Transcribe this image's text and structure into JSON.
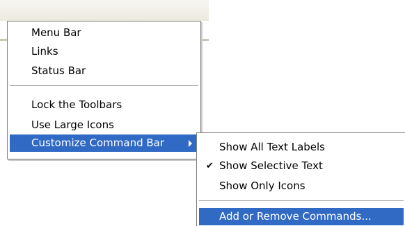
{
  "main_menu": {
    "items": [
      {
        "label": "Menu Bar"
      },
      {
        "label": "Links"
      },
      {
        "label": "Status Bar"
      },
      {
        "label": "Lock the Toolbars"
      },
      {
        "label": "Use Large Icons"
      },
      {
        "label": "Customize Command Bar",
        "highlighted": true,
        "submenu_arrow": "right-arrow-icon"
      }
    ]
  },
  "sub_menu": {
    "items": [
      {
        "label": "Show All Text Labels"
      },
      {
        "label": "Show Selective Text",
        "checked": true,
        "check_icon": "checkmark-icon"
      },
      {
        "label": "Show Only Icons"
      },
      {
        "label": "Add or Remove Commands...",
        "highlighted": true
      }
    ]
  },
  "colors": {
    "highlight": "#316ac5",
    "highlight_text": "#ffffff",
    "menu_border": "#7f7f7f"
  }
}
